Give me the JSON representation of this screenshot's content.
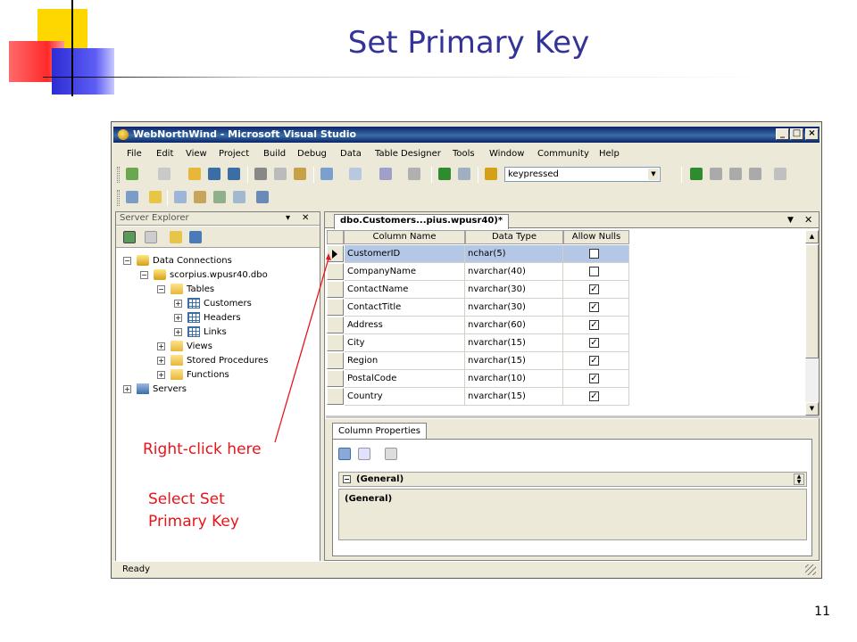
{
  "slide": {
    "title": "Set Primary Key",
    "page_number": "11",
    "annotation_right_click": "Right-click here",
    "annotation_select_line1": "Select Set",
    "annotation_select_line2": "Primary Key",
    "annotation_color": "#e8141a",
    "title_color": "#33339a"
  },
  "window": {
    "title": "WebNorthWind - Microsoft Visual Studio",
    "min_btn": "_",
    "max_btn": "□",
    "close_btn": "×"
  },
  "menu": [
    "File",
    "Edit",
    "View",
    "Project",
    "Build",
    "Debug",
    "Data",
    "Table Designer",
    "Tools",
    "Window",
    "Community",
    "Help"
  ],
  "toolbar": {
    "combo_value": "keypressed"
  },
  "server_explorer": {
    "title": "Server Explorer",
    "pin": "▾",
    "close": "✕",
    "tree": [
      {
        "toggle": "−",
        "icon": "db",
        "label": "Data Connections",
        "level": 0
      },
      {
        "toggle": "−",
        "icon": "db",
        "label": "scorpius.wpusr40.dbo",
        "level": 1
      },
      {
        "toggle": "−",
        "icon": "folder",
        "label": "Tables",
        "level": 2
      },
      {
        "toggle": "+",
        "icon": "table",
        "label": "Customers",
        "level": 3
      },
      {
        "toggle": "+",
        "icon": "table",
        "label": "Headers",
        "level": 3
      },
      {
        "toggle": "+",
        "icon": "table",
        "label": "Links",
        "level": 3
      },
      {
        "toggle": "+",
        "icon": "folder",
        "label": "Views",
        "level": 2
      },
      {
        "toggle": "+",
        "icon": "folder",
        "label": "Stored Procedures",
        "level": 2
      },
      {
        "toggle": "+",
        "icon": "folder",
        "label": "Functions",
        "level": 2
      },
      {
        "toggle": "+",
        "icon": "server",
        "label": "Servers",
        "level": 0
      }
    ]
  },
  "designer": {
    "tab_label": "dbo.Customers...pius.wpusr40)*",
    "tab_dropdown": "▼",
    "tab_close": "✕",
    "headers": [
      "Column Name",
      "Data Type",
      "Allow Nulls"
    ],
    "rows": [
      {
        "name": "CustomerID",
        "type": "nchar(5)",
        "nulls": false,
        "selected": true
      },
      {
        "name": "CompanyName",
        "type": "nvarchar(40)",
        "nulls": false,
        "selected": false
      },
      {
        "name": "ContactName",
        "type": "nvarchar(30)",
        "nulls": true,
        "selected": false
      },
      {
        "name": "ContactTitle",
        "type": "nvarchar(30)",
        "nulls": true,
        "selected": false
      },
      {
        "name": "Address",
        "type": "nvarchar(60)",
        "nulls": true,
        "selected": false
      },
      {
        "name": "City",
        "type": "nvarchar(15)",
        "nulls": true,
        "selected": false
      },
      {
        "name": "Region",
        "type": "nvarchar(15)",
        "nulls": true,
        "selected": false
      },
      {
        "name": "PostalCode",
        "type": "nvarchar(10)",
        "nulls": true,
        "selected": false
      },
      {
        "name": "Country",
        "type": "nvarchar(15)",
        "nulls": true,
        "selected": false
      }
    ],
    "properties_tab": "Column Properties",
    "group_label": "(General)",
    "description_label": "(General)"
  },
  "status": {
    "text": "Ready"
  }
}
